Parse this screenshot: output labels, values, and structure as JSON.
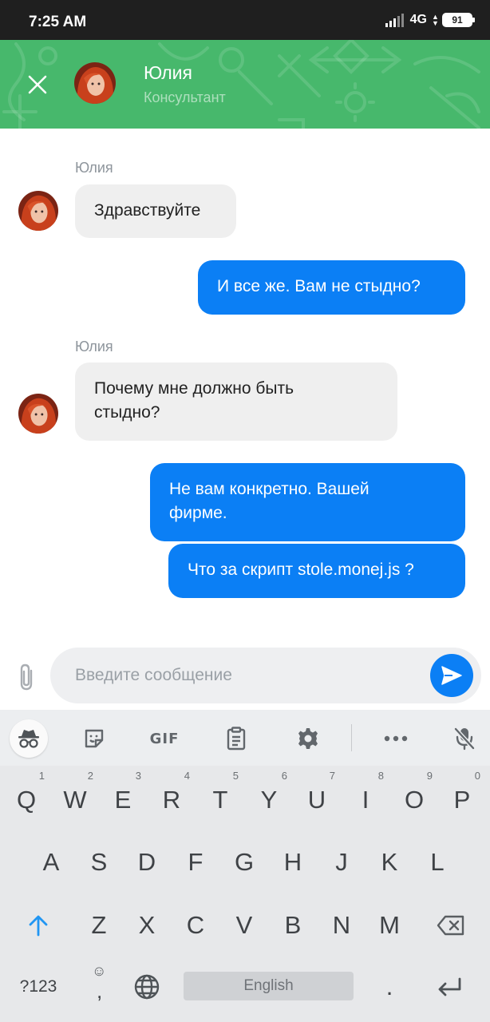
{
  "status_bar": {
    "time": "7:25 AM",
    "network": "4G",
    "battery": "91"
  },
  "header": {
    "name": "Юлия",
    "role": "Консультант"
  },
  "messages": [
    {
      "direction": "in",
      "sender": "Юлия",
      "lines": [
        "Здравствуйте"
      ]
    },
    {
      "direction": "out",
      "lines": [
        "И все же. Вам не стыдно?"
      ]
    },
    {
      "direction": "in",
      "sender": "Юлия",
      "lines": [
        "Почему мне должно быть",
        "стыдно?"
      ]
    },
    {
      "direction": "out",
      "lines": [
        "Не вам конкретно. Вашей",
        "фирме."
      ]
    },
    {
      "direction": "out",
      "lines": [
        "Что за скрипт stole.monej.js ?"
      ]
    }
  ],
  "composer": {
    "placeholder": "Введите сообщение"
  },
  "keyboard": {
    "toolbar": {
      "gif": "GIF"
    },
    "row1": [
      {
        "k": "Q",
        "n": "1"
      },
      {
        "k": "W",
        "n": "2"
      },
      {
        "k": "E",
        "n": "3"
      },
      {
        "k": "R",
        "n": "4"
      },
      {
        "k": "T",
        "n": "5"
      },
      {
        "k": "Y",
        "n": "6"
      },
      {
        "k": "U",
        "n": "7"
      },
      {
        "k": "I",
        "n": "8"
      },
      {
        "k": "O",
        "n": "9"
      },
      {
        "k": "P",
        "n": "0"
      }
    ],
    "row2": [
      "A",
      "S",
      "D",
      "F",
      "G",
      "H",
      "J",
      "K",
      "L"
    ],
    "row3": [
      "Z",
      "X",
      "C",
      "V",
      "B",
      "N",
      "M"
    ],
    "symbols_label": "?123",
    "comma": ",",
    "space_label": "English",
    "period": "."
  },
  "colors": {
    "header": "#47b86c",
    "outgoing": "#0b7ff5",
    "incoming": "#efefef"
  }
}
